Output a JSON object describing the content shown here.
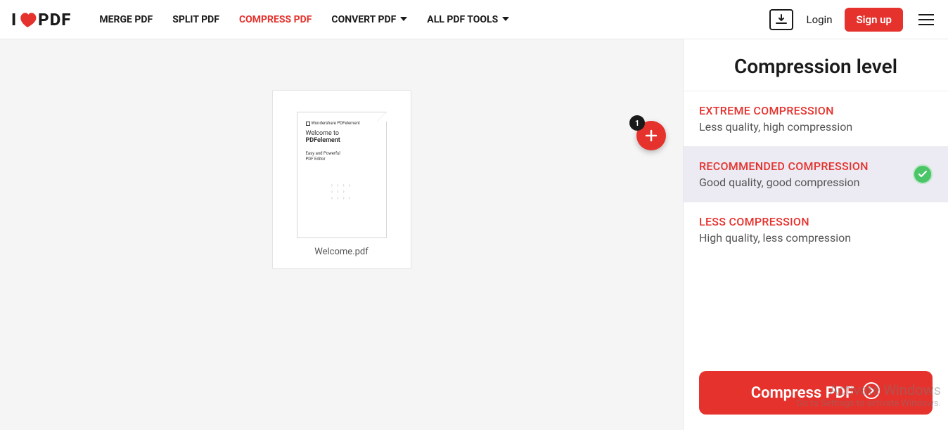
{
  "header": {
    "logo": {
      "left": "I",
      "right": "PDF"
    },
    "nav": {
      "merge": "MERGE PDF",
      "split": "SPLIT PDF",
      "compress": "COMPRESS PDF",
      "convert": "CONVERT PDF",
      "all_tools": "ALL PDF TOOLS"
    },
    "login": "Login",
    "signup": "Sign up"
  },
  "workspace": {
    "file": {
      "name": "Welcome.pdf",
      "thumb": {
        "brand": "Wondershare PDFelement",
        "line1": "Welcome to",
        "line2": "PDFelement",
        "sub1": "Easy and Powerful",
        "sub2": "PDF Editor"
      }
    },
    "add_badge": "1"
  },
  "sidebar": {
    "title": "Compression level",
    "options": [
      {
        "title": "EXTREME COMPRESSION",
        "sub": "Less quality, high compression",
        "selected": false
      },
      {
        "title": "RECOMMENDED COMPRESSION",
        "sub": "Good quality, good compression",
        "selected": true
      },
      {
        "title": "LESS COMPRESSION",
        "sub": "High quality, less compression",
        "selected": false
      }
    ],
    "action": "Compress PDF"
  },
  "watermark": {
    "line1": "Activate Windows",
    "line2": "Go to Settings to activate Windows."
  }
}
